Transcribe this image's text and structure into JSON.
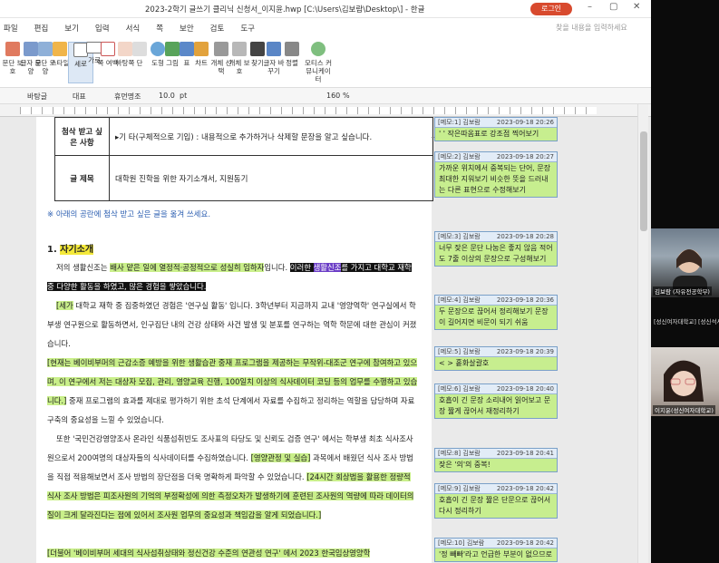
{
  "window": {
    "title": "2023-2학기 글쓰기 클리닉 신청서_이지윤.hwp [C:\\Users\\김보람\\Desktop\\] - 한글",
    "login_label": "로그인",
    "search_placeholder": "찾을 내용을 입력하세요"
  },
  "menu": [
    "파일",
    "편집",
    "보기",
    "입력",
    "서식",
    "쪽",
    "보안",
    "검토",
    "도구"
  ],
  "ribbon": [
    {
      "label": "문단 보호",
      "icon": "paragraph-protect-icon"
    },
    {
      "label": "글자 모양",
      "icon": "char-shape-icon"
    },
    {
      "label": "문단 모양",
      "icon": "para-shape-icon"
    },
    {
      "label": "스타일",
      "icon": "style-icon"
    },
    {
      "label": "세로",
      "icon": "portrait-icon",
      "active": true
    },
    {
      "label": "가로",
      "icon": "landscape-icon"
    },
    {
      "label": "쪽 여백",
      "icon": "margin-icon"
    },
    {
      "label": "바탕쪽",
      "icon": "master-page-icon"
    },
    {
      "label": "단",
      "icon": "columns-icon"
    },
    {
      "label": "도형",
      "icon": "shape-icon"
    },
    {
      "label": "그림",
      "icon": "picture-icon"
    },
    {
      "label": "표",
      "icon": "table-icon"
    },
    {
      "label": "차트",
      "icon": "chart-icon"
    },
    {
      "label": "개체 선택",
      "icon": "select-object-icon"
    },
    {
      "label": "개체 보호",
      "icon": "protect-object-icon"
    },
    {
      "label": "찾기",
      "icon": "find-icon"
    },
    {
      "label": "글자 바꾸기",
      "icon": "replace-icon"
    },
    {
      "label": "정렬",
      "icon": "sort-icon"
    },
    {
      "label": "모티스 커뮤니케이터",
      "icon": "communicator-icon"
    }
  ],
  "format": {
    "style": "바탕글",
    "lang": "대표",
    "font": "휴먼명조",
    "size": "10.0",
    "unit": "pt",
    "zoom": "160",
    "zoom_unit": "%"
  },
  "doc": {
    "table": [
      {
        "key": "첨삭 받고 싶은 사항",
        "value": "▸기 타(구체적으로 기입) : 내용적으로 추가하거나 삭제할 문장을 알고 싶습니다."
      },
      {
        "key": "글 제목",
        "value": "대학원 진학을 위한 자기소개서, 지원동기"
      }
    ],
    "note": "※ 아래의 공란에 첨삭 받고 싶은 글을 옮겨 쓰세요.",
    "heading_num": "1.",
    "heading": "자기소개",
    "p1_a": "저의 생활신조는 ",
    "p1_b": "배사 맡은 일에 열정적·공정적으로 성실히 임하자",
    "p1_c": "입니다. ",
    "p1_d": "이러한 ",
    "p1_e": "생활신조",
    "p1_f": "를 가지고 대학교 재학 중 다양한 활동을 하였고, 많은 경험을 쌓았습니다.",
    "p2_a": "[세가",
    "p2_b": " 대학교 재학 중 집중하였던 경험은 '연구실 활동' 입니다. 3학년부터 지금까지 교내 '영양역학' 연구실에서 학부생 연구원으로 활동하면서, 인구집단 내의 건강 상태와 사건 발생 및 분포를 연구하는 역학 학문에 대한 관심이 커졌습니다.",
    "p3_a": "[현재는 베이비부머의 근감소증 예방을 위한 생활습관 중재 프로그램을 제공하는 무작위-대조군 연구에 참여하고 있으며, 이 연구에서 저는 대상자 모집, 관리, 영양교육 진행, 100일치 이상의 식사데이터 코딩 등의 업무를 수행하고 있습니다.]",
    "p3_b": " 중재 프로그램의 효과를 제대로 평가하기 위한 초석 단계에서 자료를 수집하고 정리하는 역할을 담당하며 자료 구축의 중요성을 느낄 수 있었습니다.",
    "p4_a": "또한 '국민건강영양조사 온라인 식품섭취빈도 조사표의 타당도 및 신뢰도 검증 연구' 에서는 학부생 최초 식사조사원으로서 200여명의 대상자들의 식사데이터를 수집하였습니다. ",
    "p4_b": "[영양관정 및 실습]",
    "p4_c": " 과목에서 배웠던 식사 조사 방법을 직접 적용해보면서 조사 방법의 장단점을 더욱 명확하게 파악할 수 있었습니다. ",
    "p4_d": "[24시간 회상법을 활용한 정량적 식사 조사 방법은 피조사원의 기억의 부정확성에 의한 측정오차가 발생하기에 훈련된 조사원의 역량에 따라 데이터의 질이 크게 달라진다는 점에 있어서 조사원 업무의 중요성과 책임감을 알게 되었습니다.]",
    "p5_a": "[더불어 '베이비부머 세대의 식사섭취상태와 정신건강 수준의 연관성 연구' 에서 2023 한국임상영양학"
  },
  "comments": [
    {
      "head": "[메모:1] 김보람",
      "date": "2023-09-18 20:26",
      "body": "' ' 작은따옴표로 강조점 찍어보기"
    },
    {
      "head": "[메모:2] 김보람",
      "date": "2023-09-18 20:27",
      "body": "가까운 위치에서 중복되는 단어, 문장 최대한 지워보기 비슷한 뜻을 드러내는 다른 표현으로 수정해보기"
    },
    {
      "head": "[메모:3] 김보람",
      "date": "2023-09-18 20:28",
      "body": "너무 잦은 문단 나눔은 좋지 않음 적어도 7줄 이상의 문장으로 구성해보기"
    },
    {
      "head": "[메모:4] 김보람",
      "date": "2023-09-18 20:36",
      "body": "두 문장으로 끊어서 정리해보기 문장이 길어지면 비문이 되기 쉬움"
    },
    {
      "head": "[메모:5] 김보람",
      "date": "2023-09-18 20:39",
      "body": "< > 홑화살괄호"
    },
    {
      "head": "[메모:6] 김보람",
      "date": "2023-09-18 20:40",
      "body": "호흡이 긴 문장 소리내어 읽어보고 문장 짧게 끊어서 재정리하기"
    },
    {
      "head": "[메모:8] 김보람",
      "date": "2023-09-18 20:41",
      "body": "잦은 '의'의 중복!"
    },
    {
      "head": "[메모:9] 김보람",
      "date": "2023-09-18 20:42",
      "body": "호흡이 긴 문장 짧은 단문으로 끊어서 다시 정리하기"
    },
    {
      "head": "[메모:10] 김보람",
      "date": "2023-09-18 20:42",
      "body": "'정 빼빠'라고 언급한 부분이 없으므로"
    }
  ],
  "participants": [
    {
      "name": "김보람 (자유전공학부)"
    },
    {
      "name": "[성신여자대학교] [성신석사과정]"
    },
    {
      "name": "이지윤(성신여자대학교)"
    }
  ],
  "colors": {
    "comment_bg": "#c7ee8f",
    "highlight_green": "#c9ef8a",
    "highlight_yellow": "#f4e93a",
    "note_blue": "#2a5db0",
    "login_red": "#d84a2e"
  }
}
